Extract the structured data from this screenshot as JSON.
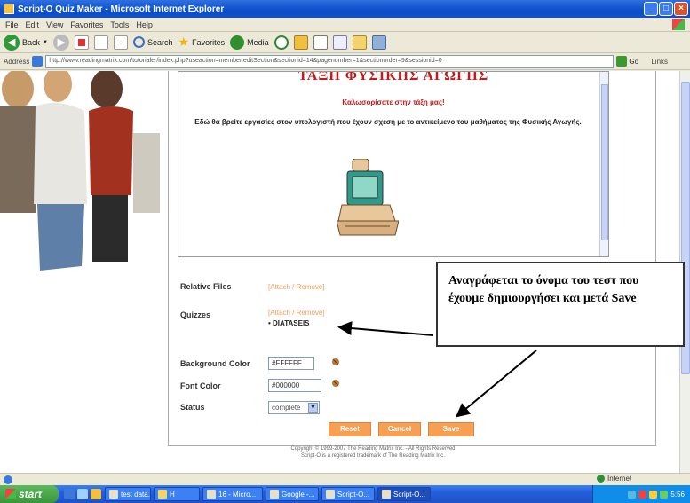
{
  "window": {
    "title": "Script-O Quiz Maker - Microsoft Internet Explorer"
  },
  "menu": [
    "File",
    "Edit",
    "View",
    "Favorites",
    "Tools",
    "Help"
  ],
  "toolbar": {
    "back": "Back",
    "search": "Search",
    "favorites": "Favorites",
    "media": "Media"
  },
  "address": {
    "label": "Address",
    "url": "http://www.readingmatrix.com/tutorialer/index.php?useaction=member.editSection&sectionid=14&pagenumber=1&sectionorder=9&sessionid=0",
    "go": "Go",
    "links": "Links"
  },
  "content": {
    "title": "ΤΑΞΗ ΦΥΣΙΚΗΣ ΑΓΩΓΗΣ",
    "welcome": "Καλωσορίσατε στην τάξη μας!",
    "description": "Εδώ θα βρείτε εργασίες στον υπολογιστή που έχουν σχέση με το αντικείμενο του μαθήματος της Φυσικής Αγωγής."
  },
  "form": {
    "related_files_label": "Relative Files",
    "related_files_link": "[Attach / Remove]",
    "quizzes_label": "Quizzes",
    "quizzes_link": "[Attach / Remove]",
    "quiz_item": "• DIATASEIS",
    "bg_color_label": "Background Color",
    "bg_color_value": "#FFFFFF",
    "font_color_label": "Font Color",
    "font_color_value": "#000000",
    "status_label": "Status",
    "status_value": "complete",
    "reset": "Reset",
    "cancel": "Cancel",
    "save": "Save"
  },
  "footer": {
    "line1": "Copyright © 1999-2007 The Reading Matrix Inc. - All Rights Reserved",
    "line2": "Script-O is a registered trademark of The Reading Matrix Inc."
  },
  "callout": {
    "text": "Αναγράφεται το όνομα του τεστ που έχουμε δημιουργήσει και μετά Save"
  },
  "status": {
    "zone": "Internet"
  },
  "taskbar": {
    "start": "start",
    "tasks": [
      "test data...",
      "H",
      "16 - Micro...",
      "Google -...",
      "Script-O...",
      "Script-O..."
    ],
    "clock": "5:56"
  },
  "colors": {
    "title_red": "#c81818",
    "link_orange": "#f29d5b",
    "button_orange": "#f5a054",
    "xp_blue": "#245edb"
  }
}
